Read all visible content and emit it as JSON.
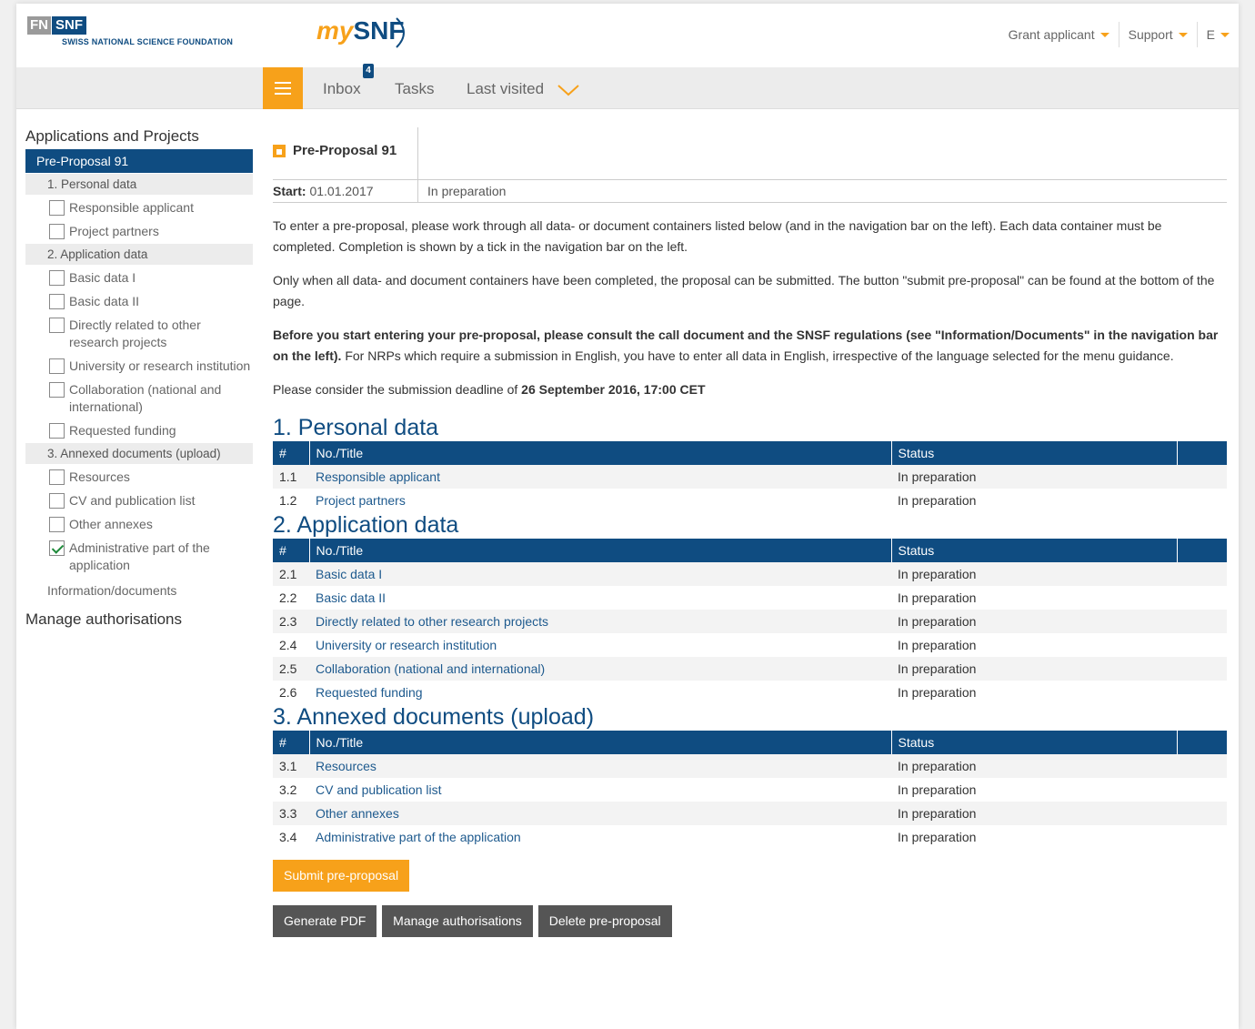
{
  "header": {
    "logo_fn": "FN",
    "logo_snf": "SNF",
    "logo_sub": "SWISS NATIONAL SCIENCE FOUNDATION",
    "mysnf_my": "my",
    "mysnf_snf": "SNF",
    "nav": [
      {
        "label": "Grant applicant"
      },
      {
        "label": "Support"
      },
      {
        "label": "E"
      }
    ]
  },
  "navbar": {
    "inbox": "Inbox",
    "inbox_badge": "4",
    "tasks": "Tasks",
    "last_visited": "Last visited"
  },
  "colors": {
    "accent": "#f7a11a",
    "primary": "#0f4c81"
  },
  "sidebar": {
    "heading": "Applications and Projects",
    "active": "Pre-Proposal 91",
    "groups": [
      {
        "label": "1. Personal data",
        "items": [
          {
            "label": "Responsible applicant",
            "checked": false
          },
          {
            "label": "Project partners",
            "checked": false
          }
        ]
      },
      {
        "label": "2. Application data",
        "items": [
          {
            "label": "Basic data I",
            "checked": false
          },
          {
            "label": "Basic data II",
            "checked": false
          },
          {
            "label": "Directly related to other research projects",
            "checked": false
          },
          {
            "label": "University or research institution",
            "checked": false
          },
          {
            "label": "Collaboration (national and international)",
            "checked": false
          },
          {
            "label": "Requested funding",
            "checked": false
          }
        ]
      },
      {
        "label": "3. Annexed documents (upload)",
        "items": [
          {
            "label": "Resources",
            "checked": false
          },
          {
            "label": "CV and publication list",
            "checked": false
          },
          {
            "label": "Other annexes",
            "checked": false
          },
          {
            "label": "Administrative part of the application",
            "checked": true
          }
        ]
      }
    ],
    "info_docs": "Information/documents",
    "manage_auth": "Manage authorisations"
  },
  "main": {
    "title": "Pre-Proposal 91",
    "start_label": "Start:",
    "start_value": "01.01.2017",
    "status": "In preparation",
    "intro1": "To enter a pre-proposal, please work through all data- or document containers listed below (and in the navigation bar on the left). Each data container must be completed. Completion is shown by a tick in the navigation bar on the left.",
    "intro2": "Only when all data- and document containers have been completed, the proposal can be submitted. The button \"submit pre-proposal\" can be found at the bottom of the page.",
    "intro3_bold": "Before you start entering your pre-proposal, please consult the call document and the SNSF regulations (see \"Information/Documents\" in the navigation bar on the left).",
    "intro3_rest": " For NRPs which require a submission in English, you have to enter all data in English, irrespective of the language selected for the menu guidance.",
    "deadline_pre": "Please consider the submission deadline of ",
    "deadline_bold": "26 September 2016, 17:00 CET",
    "col_num": "#",
    "col_title": "No./Title",
    "col_status": "Status",
    "sections": [
      {
        "heading": "1. Personal data",
        "rows": [
          {
            "num": "1.1",
            "title": "Responsible applicant",
            "status": "In preparation"
          },
          {
            "num": "1.2",
            "title": "Project partners",
            "status": "In preparation"
          }
        ]
      },
      {
        "heading": "2. Application data",
        "rows": [
          {
            "num": "2.1",
            "title": "Basic data I",
            "status": "In preparation"
          },
          {
            "num": "2.2",
            "title": "Basic data II",
            "status": "In preparation"
          },
          {
            "num": "2.3",
            "title": "Directly related to other research projects",
            "status": "In preparation"
          },
          {
            "num": "2.4",
            "title": "University or research institution",
            "status": "In preparation"
          },
          {
            "num": "2.5",
            "title": "Collaboration (national and international)",
            "status": "In preparation"
          },
          {
            "num": "2.6",
            "title": "Requested funding",
            "status": "In preparation"
          }
        ]
      },
      {
        "heading": "3. Annexed documents (upload)",
        "rows": [
          {
            "num": "3.1",
            "title": "Resources",
            "status": "In preparation"
          },
          {
            "num": "3.2",
            "title": "CV and publication list",
            "status": "In preparation"
          },
          {
            "num": "3.3",
            "title": "Other annexes",
            "status": "In preparation"
          },
          {
            "num": "3.4",
            "title": "Administrative part of the application",
            "status": "In preparation"
          }
        ]
      }
    ],
    "btn_submit": "Submit pre-proposal",
    "btn_pdf": "Generate PDF",
    "btn_auth": "Manage authorisations",
    "btn_delete": "Delete pre-proposal"
  }
}
